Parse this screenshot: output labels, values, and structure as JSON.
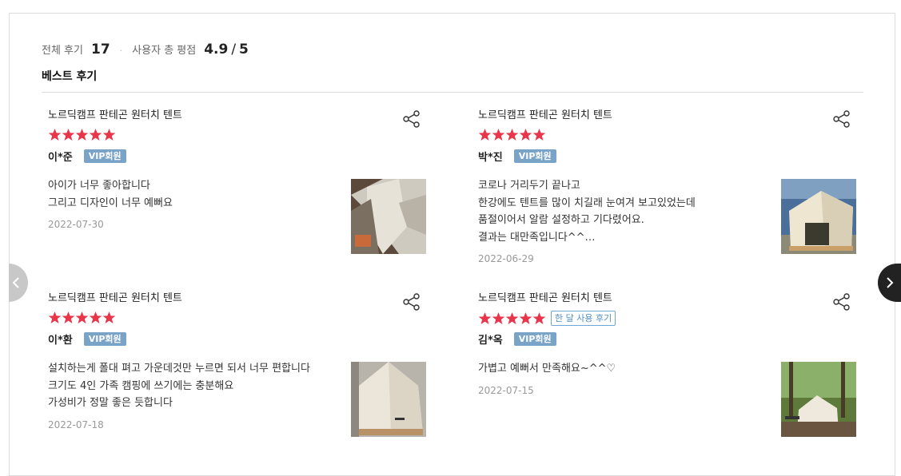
{
  "summary": {
    "total_label": "전체 후기",
    "total_count": "17",
    "rating_label": "사용자 총 평점",
    "rating_value": "4.9",
    "rating_max": "5"
  },
  "best_title": "베스트 후기",
  "star_color": "#e8354a",
  "reviews": [
    {
      "product": "노르딕캠프 판테곤 원터치 텐트",
      "rating": 5,
      "user": "이*준",
      "badge": "VIP회원",
      "lines": [
        "아이가 너무 좋아합니다",
        "그리고 디자인이 너무 예뻐요"
      ],
      "date": "2022-07-30"
    },
    {
      "product": "노르딕캠프 판테곤 원터치 텐트",
      "rating": 5,
      "user": "박*진",
      "badge": "VIP회원",
      "lines": [
        "코로나 거리두기 끝나고",
        "한강에도 텐트를 많이 치길래 눈여겨 보고있었는데",
        "품절이어서 알람 설정하고 기다렸어요.",
        "결과는 대만족입니다^^…"
      ],
      "date": "2022-06-29"
    },
    {
      "product": "노르딕캠프 판테곤 원터치 텐트",
      "rating": 5,
      "user": "이*환",
      "badge": "VIP회원",
      "lines": [
        "설치하는게 폴대 펴고 가운데것만 누르면 되서 너무 편합니다",
        "크기도 4인 가족 캠핑에 쓰기에는 충분해요",
        "가성비가 정말 좋은 듯합니다"
      ],
      "date": "2022-07-18"
    },
    {
      "product": "노르딕캠프 판테곤 원터치 텐트",
      "rating": 5,
      "month_badge": "한 달 사용 후기",
      "user": "김*옥",
      "badge": "VIP회원",
      "lines": [
        "가볍고 예뻐서 만족해요~^^♡"
      ],
      "date": "2022-07-15"
    }
  ]
}
